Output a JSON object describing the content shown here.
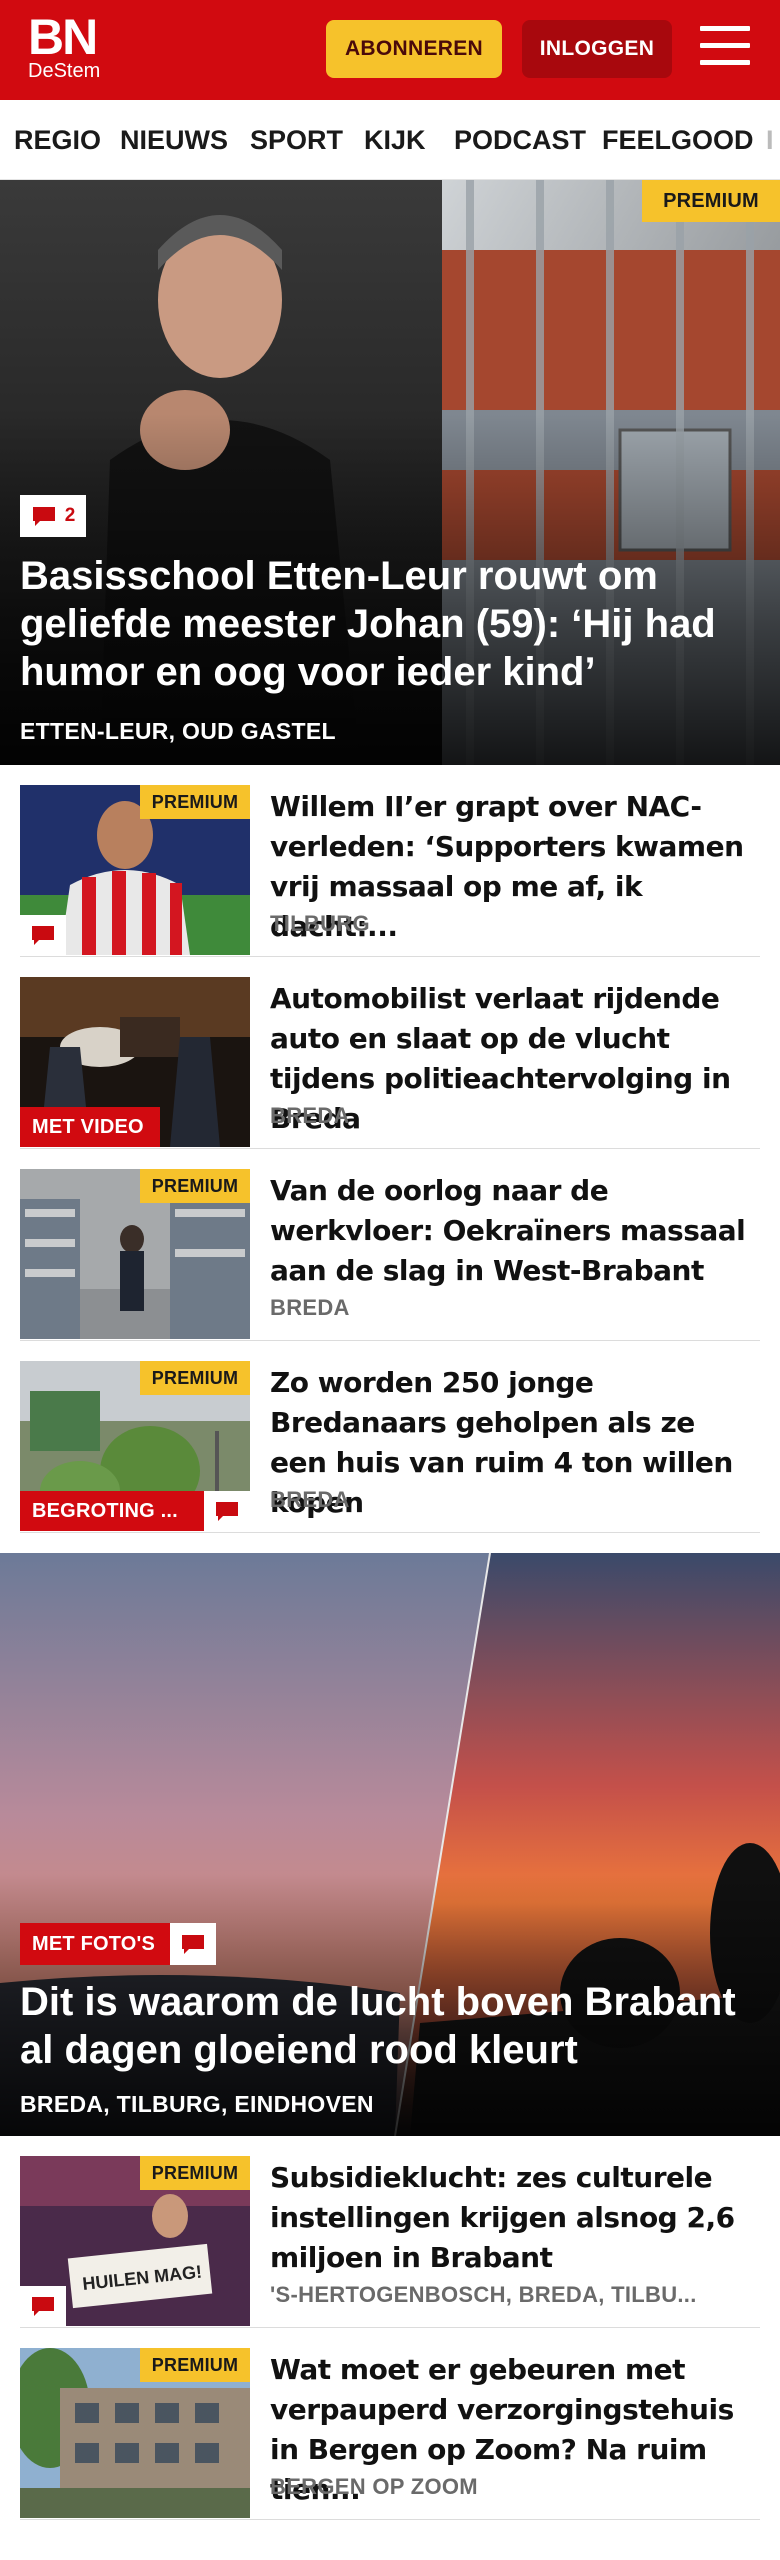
{
  "header": {
    "logo_main": "BN",
    "logo_sub": "DeStem",
    "subscribe_label": "ABONNEREN",
    "login_label": "INLOGGEN",
    "brand_color": "#d10a10",
    "accent_color": "#f6c22b"
  },
  "nav": {
    "items": [
      "REGIO",
      "NIEUWS",
      "SPORT",
      "KIJK",
      "PODCAST",
      "FEELGOOD",
      "I"
    ]
  },
  "hero1": {
    "premium_label": "PREMIUM",
    "comment_count": "2",
    "title": "Basisschool Etten-Leur rouwt om geliefde meester Johan (59): ‘Hij had humor en oog voor ieder kind’",
    "location": "ETTEN-LEUR, OUD GASTEL"
  },
  "list1": [
    {
      "title": "Willem II’er grapt over NAC-verleden: ‘Supporters kwamen vrij massaal op me af, ik dacht:...",
      "location": "TILBURG",
      "premium_label": "PREMIUM",
      "icon": "comment-icon"
    },
    {
      "title": "Automobilist verlaat rijdende auto en slaat op de vlucht tijdens politieachtervolging in Breda",
      "location": "BREDA",
      "tag_label": "MET VIDEO"
    },
    {
      "title": "Van de oorlog naar de werkvloer: Oekraïners massaal aan de slag in West-Brabant",
      "location": "BREDA",
      "premium_label": "PREMIUM"
    },
    {
      "title": "Zo worden 250 jonge Bredanaars geholpen als ze een huis van ruim 4 ton willen kopen",
      "location": "BREDA",
      "premium_label": "PREMIUM",
      "tag_label": "BEGROTING ...",
      "icon": "comment-icon"
    }
  ],
  "hero2": {
    "tag_label": "MET FOTO'S",
    "title": "Dit is waarom de lucht boven Brabant al dagen gloeiend rood kleurt",
    "location": "BREDA, TILBURG, EINDHOVEN"
  },
  "list2": [
    {
      "title": "Subsidieklucht: zes culturele instellingen krijgen alsnog 2,6 miljoen in Brabant",
      "location": "'S-HERTOGENBOSCH, BREDA, TILBU...",
      "premium_label": "PREMIUM",
      "thumb_sign": "HUILEN MAG!",
      "icon": "comment-icon"
    },
    {
      "title": "Wat moet er gebeuren met verpauperd verzorgingstehuis in Bergen op Zoom? Na ruim tien...",
      "location": "BERGEN OP ZOOM",
      "premium_label": "PREMIUM"
    }
  ]
}
